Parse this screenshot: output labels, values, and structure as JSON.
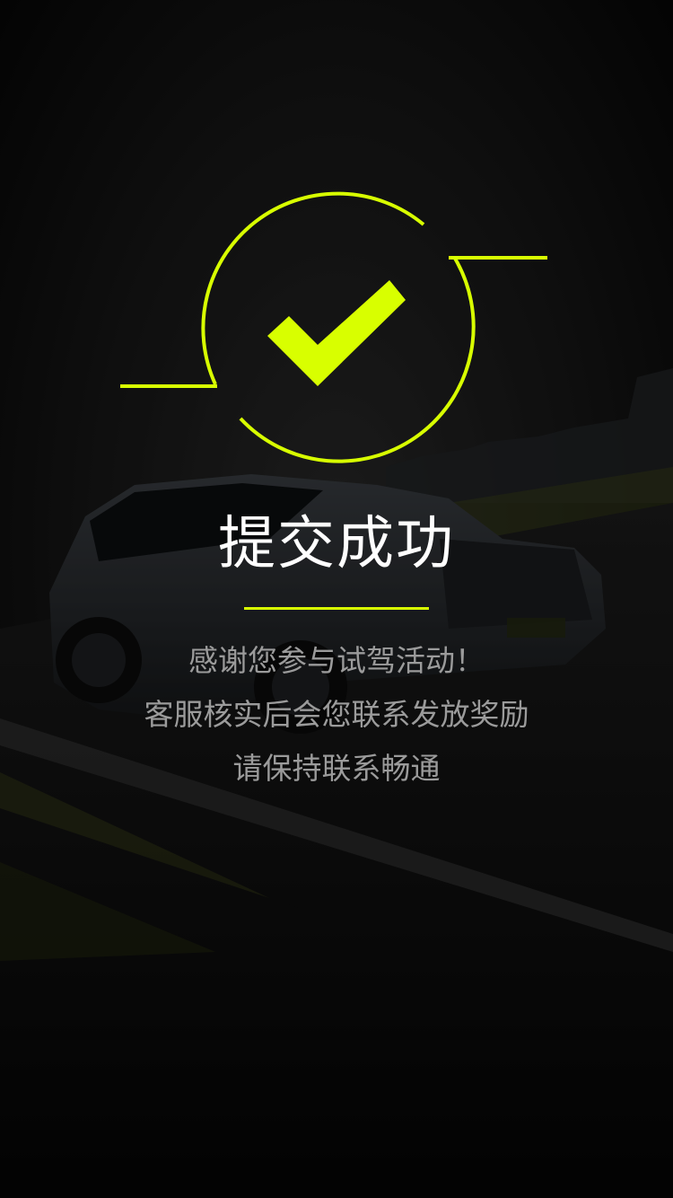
{
  "colors": {
    "accent": "#d8ff00",
    "background": "#050505",
    "title_text": "#ffffff",
    "body_text": "#9b9b9b"
  },
  "icons": {
    "success": "check-circle-icon"
  },
  "success": {
    "title": "提交成功",
    "message_lines": [
      "感谢您参与试驾活动！",
      "客服核实后会您联系发放奖励",
      "请保持联系畅通"
    ]
  }
}
